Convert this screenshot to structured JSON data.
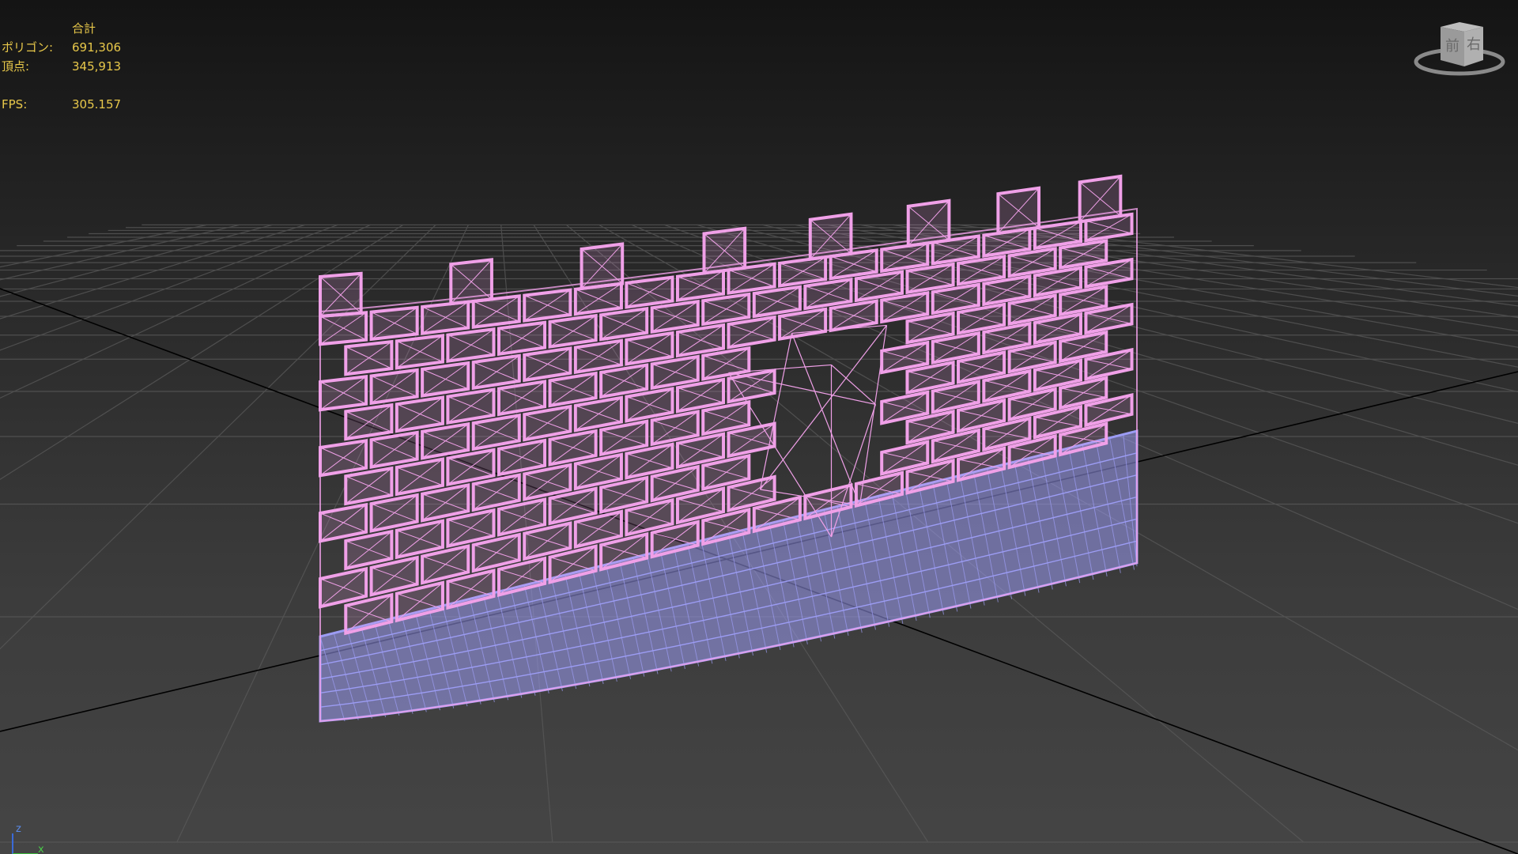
{
  "stats": {
    "header": "合計",
    "polygons_label": "ポリゴン:",
    "polygons_value": "691,306",
    "vertices_label": "頂点:",
    "vertices_value": "345,913",
    "fps_label": "FPS:",
    "fps_value": "305.157"
  },
  "viewcube": {
    "face_front": "前",
    "face_right": "右"
  },
  "axis": {
    "z": "z",
    "x": "x"
  },
  "colors": {
    "wire_pink": "#f0a0e8",
    "wire_blue": "#9c9cf4",
    "stat_text": "#e8c84a",
    "grid_line": "#5a5a5a",
    "grid_axis": "#000000"
  },
  "icons": [
    "viewcube-icon",
    "axis-tripod-icon"
  ]
}
